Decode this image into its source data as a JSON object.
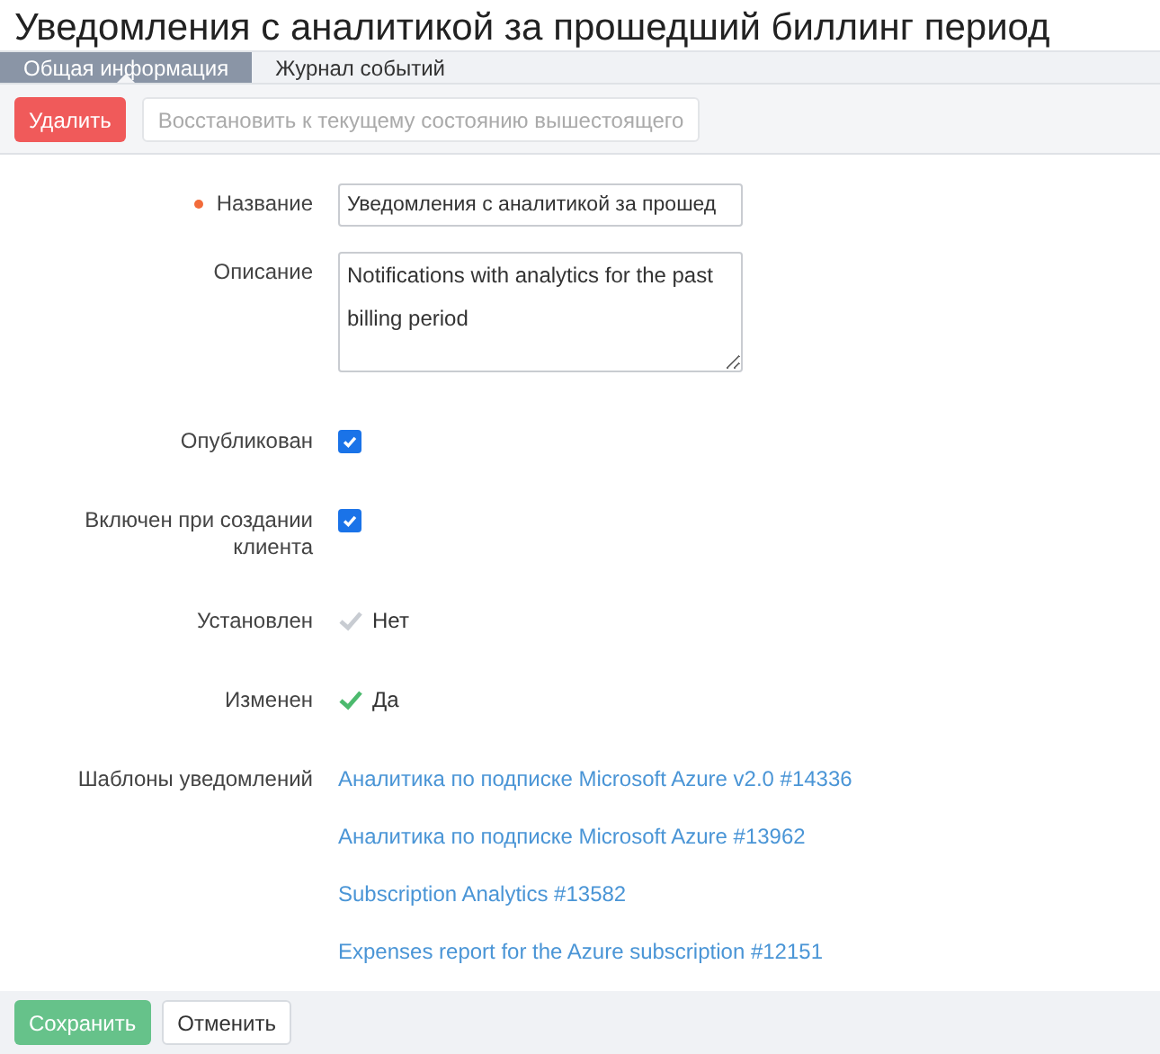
{
  "title": "Уведомления с аналитикой за прошедший биллинг период",
  "tabs": [
    {
      "label": "Общая информация",
      "selected": true
    },
    {
      "label": "Журнал событий",
      "selected": false
    }
  ],
  "toolbar": [
    {
      "label": "Удалить",
      "disabled": false,
      "kind": "danger"
    },
    {
      "label": "Восстановить к текущему состоянию вышестоящего",
      "disabled": true,
      "kind": "default"
    }
  ],
  "fields": [
    {
      "kind": "text",
      "label": "Название",
      "required": true,
      "value": "Уведомления с аналитикой за прошед"
    },
    {
      "kind": "textarea",
      "label": "Описание",
      "required": false,
      "value": "Notifications with analytics for the past billing period"
    },
    {
      "kind": "checkbox",
      "label": "Опубликован",
      "required": false,
      "checked": true
    },
    {
      "kind": "checkbox",
      "label": "Включен при создании клиента",
      "required": false,
      "checked": true
    },
    {
      "kind": "status",
      "label": "Установлен",
      "required": false,
      "on": false,
      "value": "Нет"
    },
    {
      "kind": "status",
      "label": "Изменен",
      "required": false,
      "on": true,
      "value": "Да"
    },
    {
      "kind": "links",
      "label": "Шаблоны уведомлений",
      "required": false,
      "links": [
        "Аналитика по подписке Microsoft Azure v2.0 #14336",
        "Аналитика по подписке Microsoft Azure #13962",
        "Subscription Analytics #13582",
        "Expenses report for the Azure subscription #12151"
      ]
    }
  ],
  "footer": [
    {
      "label": "Сохранить",
      "kind": "primary"
    },
    {
      "label": "Отменить",
      "kind": "default"
    }
  ]
}
